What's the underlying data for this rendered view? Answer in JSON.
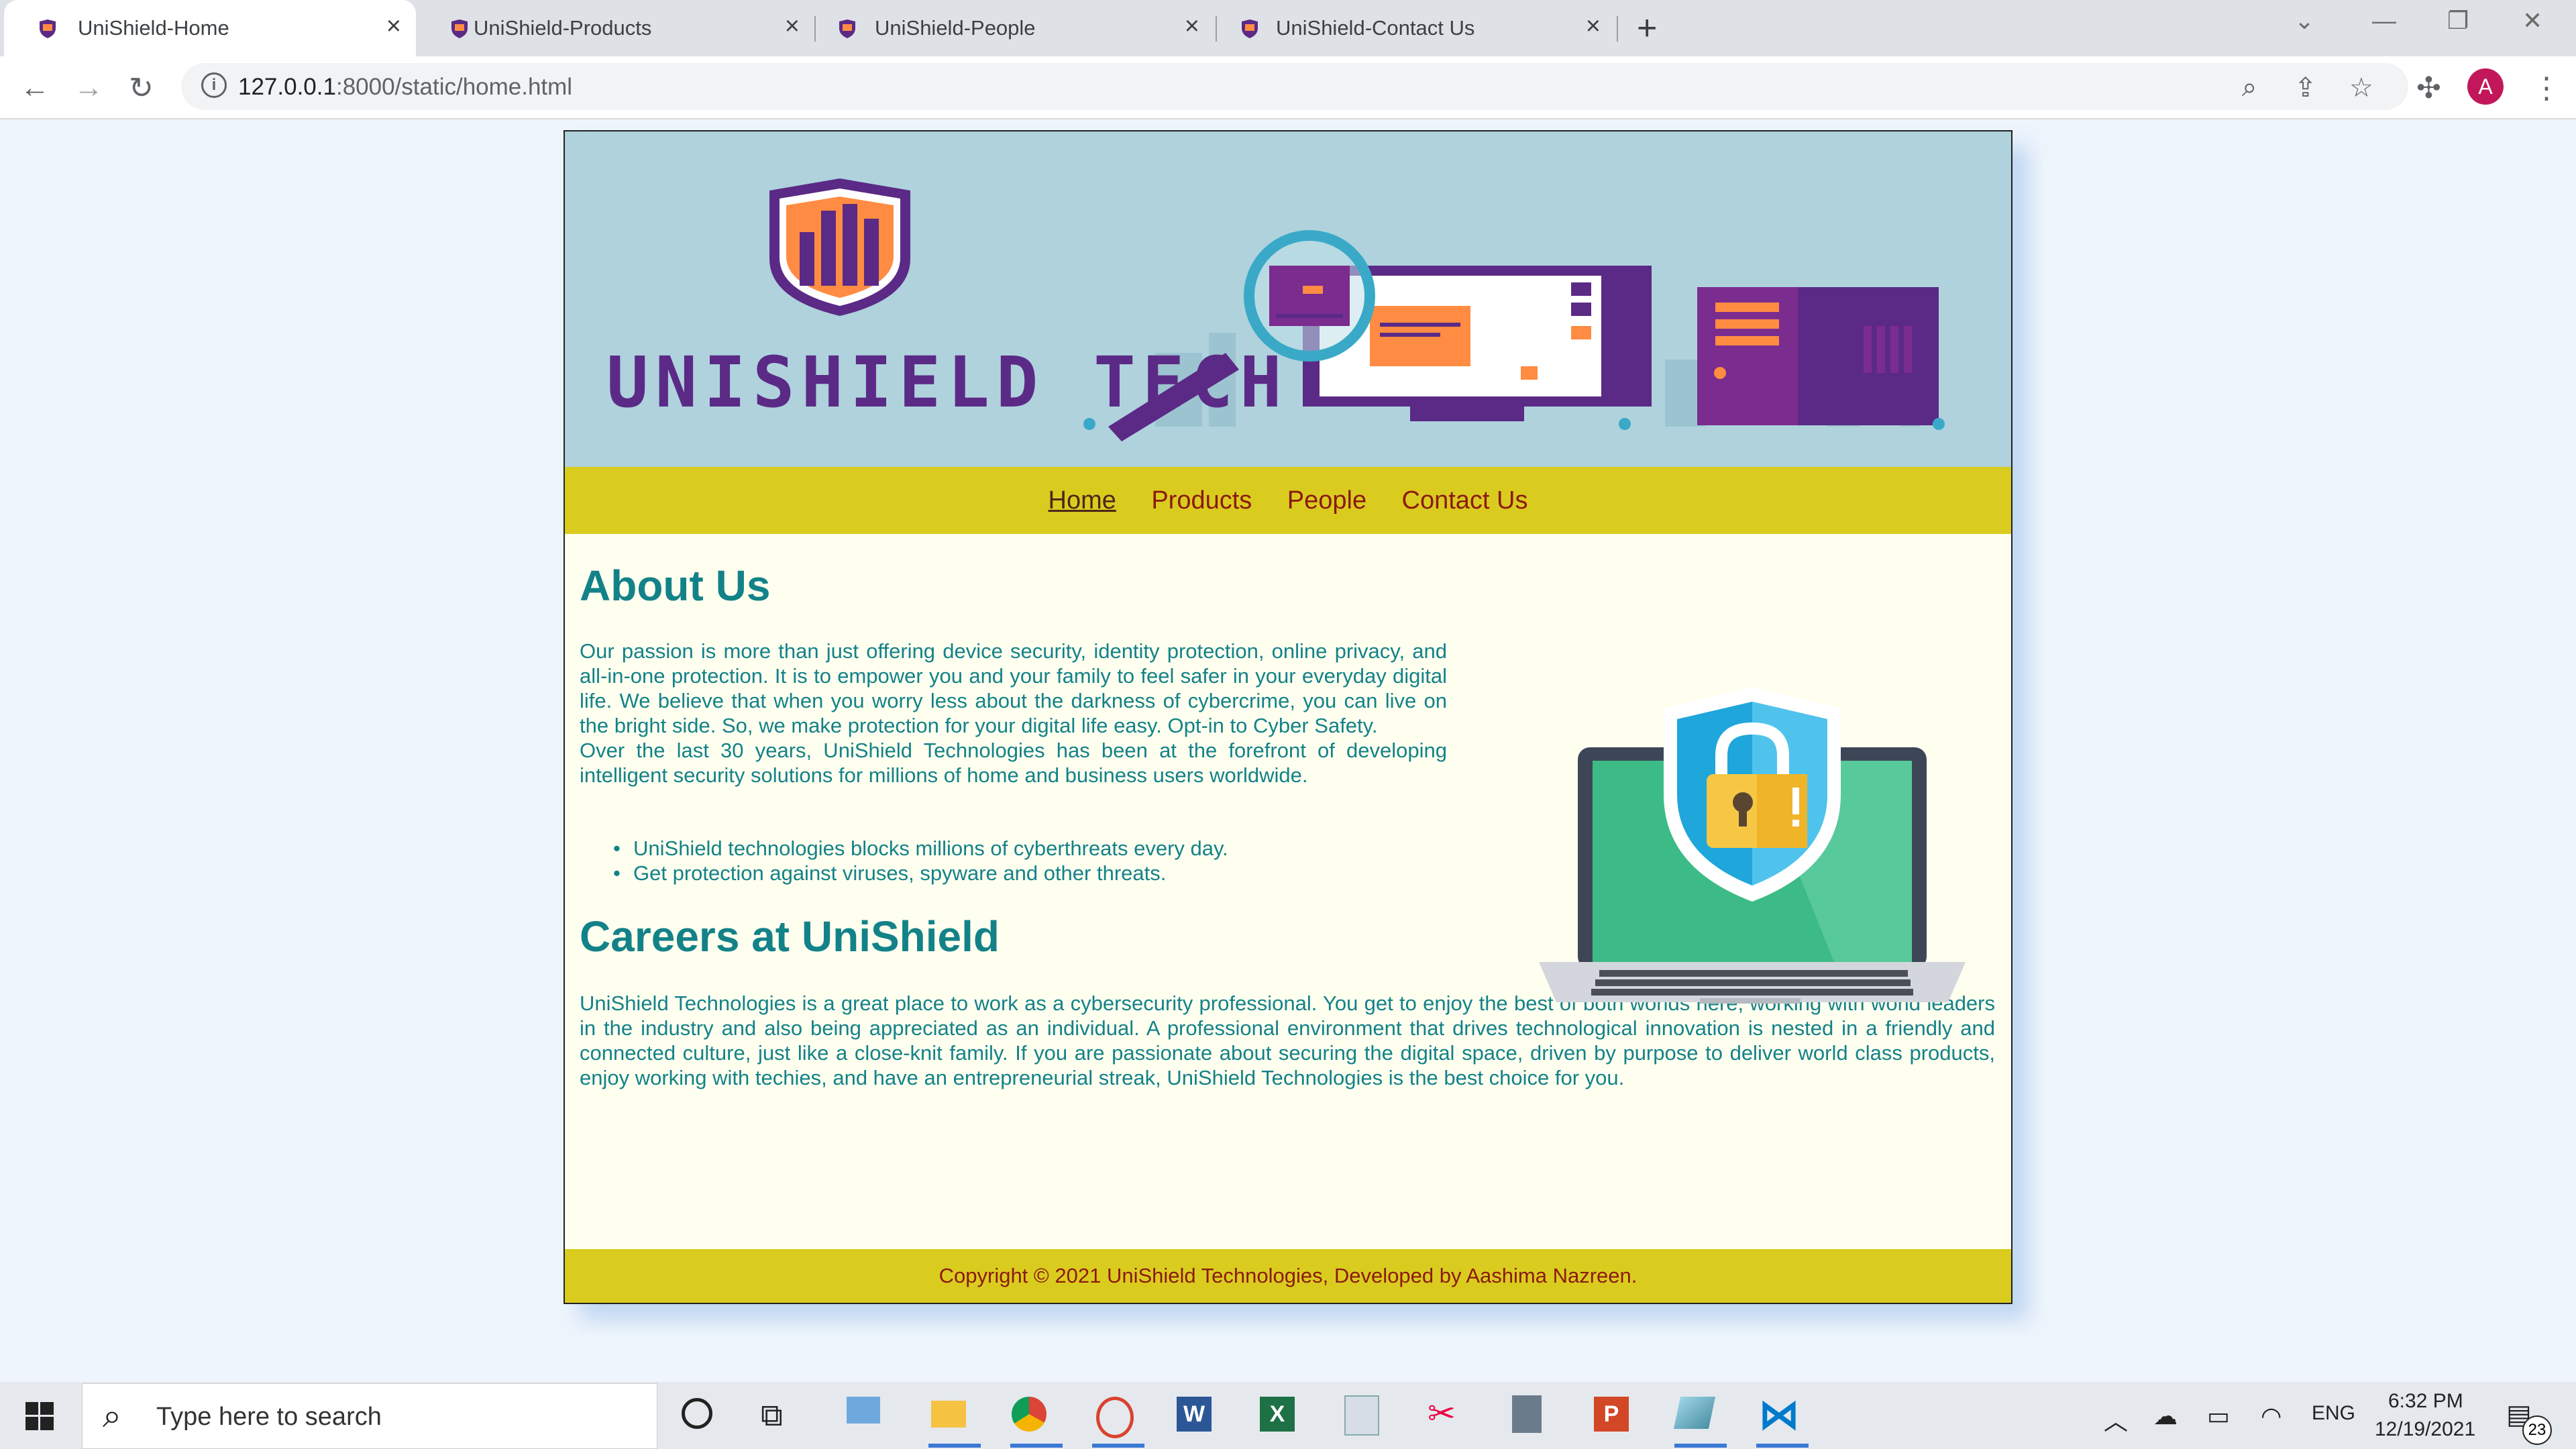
{
  "browser": {
    "tabs": [
      {
        "title": "UniShield-Home",
        "active": true
      },
      {
        "title": "UniShield-Products",
        "active": false
      },
      {
        "title": "UniShield-People",
        "active": false
      },
      {
        "title": "UniShield-Contact Us",
        "active": false
      }
    ],
    "url_host": "127.0.0.1",
    "url_rest": ":8000/static/home.html",
    "profile_initial": "A"
  },
  "banner": {
    "logo_text": "UNISHIELD TECH"
  },
  "nav": {
    "items": [
      {
        "label": "Home",
        "current": true
      },
      {
        "label": "Products",
        "current": false
      },
      {
        "label": "People",
        "current": false
      },
      {
        "label": "Contact Us",
        "current": false
      }
    ]
  },
  "about": {
    "heading": "About Us",
    "paragraph1": "Our passion is more than just offering device security, identity protection, online privacy, and all-in-one protection. It is to empower you and your family to feel safer in your everyday digital life. We believe that when you worry less about the darkness of cybercrime, you can live on the bright side. So, we make protection for your digital life easy. Opt-in to Cyber Safety.",
    "paragraph2": "Over the last 30 years, UniShield Technologies has been at the forefront of developing intelligent security solutions for millions of home and business users worldwide.",
    "bullets": [
      "UniShield technologies blocks millions of cyberthreats every day.",
      "Get protection against viruses, spyware and other threats."
    ]
  },
  "careers": {
    "heading": "Careers at UniShield",
    "paragraph": "UniShield Technologies is a great place to work as a cybersecurity professional. You get to enjoy the best of both worlds here, working with world leaders in the industry and also being appreciated as an individual. A professional environment that drives technological innovation is nested in a friendly and connected culture, just like a close-knit family. If you are passionate about securing the digital space, driven by purpose to deliver world class products, enjoy working with techies, and have an entrepreneurial streak, UniShield Technologies is the best choice for you."
  },
  "footer": {
    "text": "Copyright © 2021 UniShield Technologies, Developed by Aashima Nazreen."
  },
  "taskbar": {
    "search_placeholder": "Type here to search",
    "language": "ENG",
    "time": "6:32 PM",
    "date": "12/19/2021",
    "notification_count": "23"
  },
  "colors": {
    "banner_bg": "#afd2dd",
    "nav_bg": "#d9cc1f",
    "nav_link": "#8b1a10",
    "content_text": "#138288",
    "content_bg": "#fffff0"
  }
}
